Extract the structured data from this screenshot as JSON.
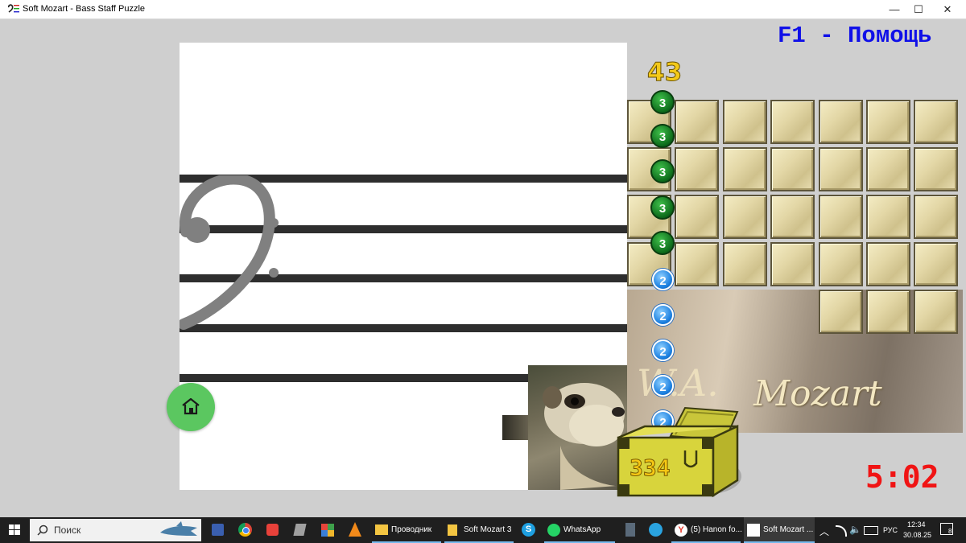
{
  "window": {
    "title": "Soft Mozart - Bass Staff Puzzle",
    "app_icon": "soft-mozart-clef-icon",
    "controls": {
      "minimize": "—",
      "maximize": "☐",
      "close": "✕"
    }
  },
  "game": {
    "help_text": "F1 - Помощь",
    "counter": "43",
    "tokens": {
      "green_label": "3",
      "blue_label": "2",
      "green_count": 5,
      "blue_count": 5
    },
    "chest_score": "334",
    "timer": "5:02",
    "mozart_signature": "Mozart",
    "mozart_initials": "W.A.",
    "home_icon": "home-icon"
  },
  "colors": {
    "help_text": "#1010e8",
    "timer": "#f01414",
    "counter": "#f3c91a",
    "home_button": "#5bc760",
    "staff_line": "#2e2e2e",
    "background": "#cfcfcf",
    "taskbar": "#1f1f1f"
  },
  "taskbar": {
    "search_placeholder": "Поиск",
    "items": [
      {
        "label": "Проводник",
        "icon": "folder-icon"
      },
      {
        "label": "Soft Mozart 3",
        "icon": "folder-icon"
      },
      {
        "label": "WhatsApp",
        "icon": "whatsapp-icon"
      },
      {
        "label": "(5) Hanon fo...",
        "icon": "yandex-browser-icon"
      },
      {
        "label": "Soft Mozart ...",
        "icon": "soft-mozart-icon"
      }
    ],
    "tray": {
      "language": "РУС",
      "time": "12:34",
      "date": "30.08.25",
      "notifications": "8"
    }
  }
}
